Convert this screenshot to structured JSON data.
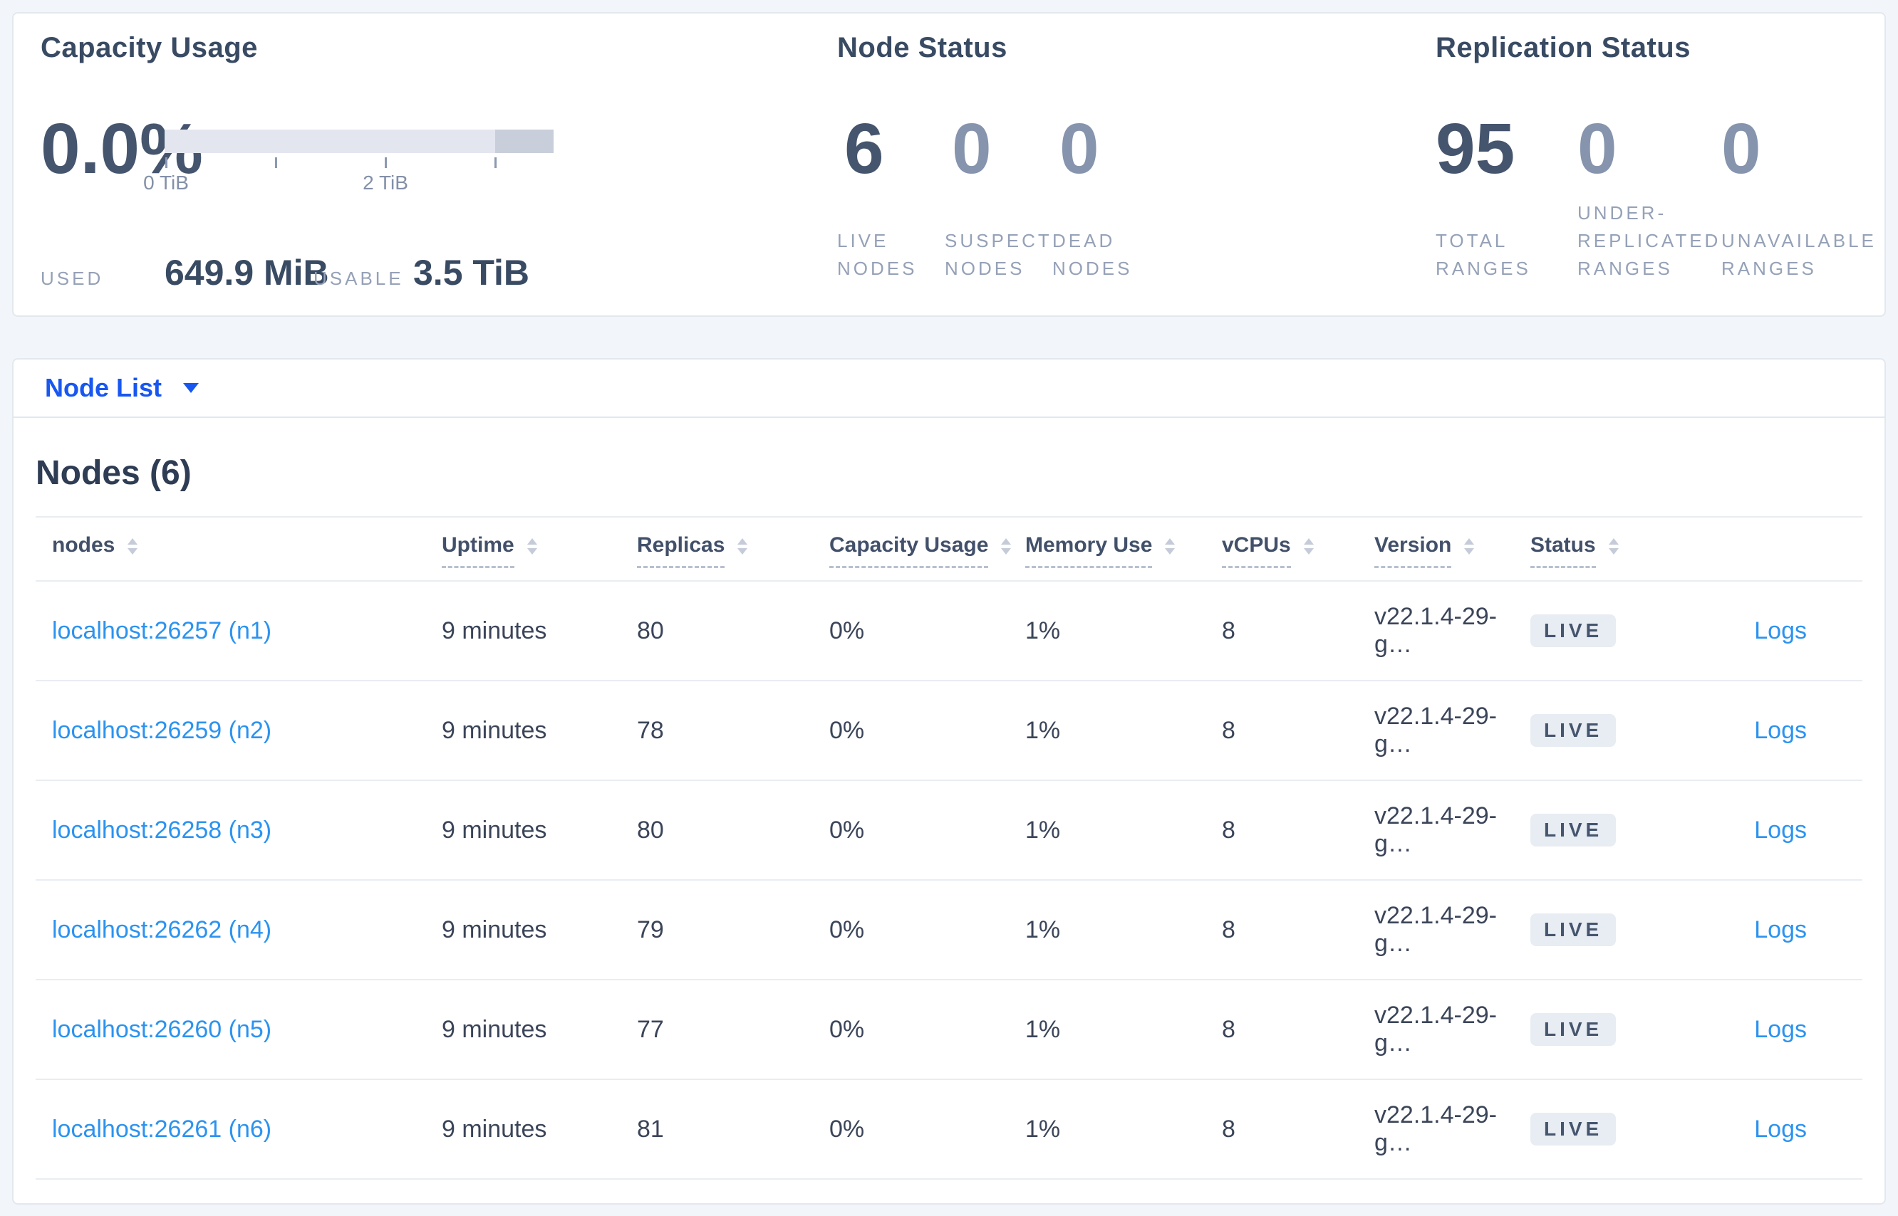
{
  "panels": {
    "capacity": {
      "title": "Capacity Usage",
      "percent": "0.0%",
      "tick_first": "0 TiB",
      "tick_third": "2 TiB",
      "used_label": "USED",
      "used_value": "649.9 MiB",
      "usable_label": "USABLE",
      "usable_value": "3.5 TiB"
    },
    "node_status": {
      "title": "Node Status",
      "stats": [
        {
          "value": "6",
          "label": "LIVE NODES"
        },
        {
          "value": "0",
          "label": "SUSPECT NODES"
        },
        {
          "value": "0",
          "label": "DEAD NODES"
        }
      ]
    },
    "replication": {
      "title": "Replication Status",
      "stats": [
        {
          "value": "95",
          "label": "TOTAL RANGES"
        },
        {
          "value": "0",
          "label": "UNDER-REPLICATED RANGES"
        },
        {
          "value": "0",
          "label": "UNAVAILABLE RANGES"
        }
      ]
    }
  },
  "node_list_dropdown": {
    "label": "Node List"
  },
  "table": {
    "heading": "Nodes (6)",
    "columns": [
      "nodes",
      "Uptime",
      "Replicas",
      "Capacity Usage",
      "Memory Use",
      "vCPUs",
      "Version",
      "Status"
    ],
    "logs_label": "Logs",
    "rows": [
      {
        "node": "localhost:26257 (n1)",
        "uptime": "9 minutes",
        "replicas": "80",
        "capacity": "0%",
        "memory": "1%",
        "vcpus": "8",
        "version": "v22.1.4-29-g…",
        "status": "LIVE"
      },
      {
        "node": "localhost:26259 (n2)",
        "uptime": "9 minutes",
        "replicas": "78",
        "capacity": "0%",
        "memory": "1%",
        "vcpus": "8",
        "version": "v22.1.4-29-g…",
        "status": "LIVE"
      },
      {
        "node": "localhost:26258 (n3)",
        "uptime": "9 minutes",
        "replicas": "80",
        "capacity": "0%",
        "memory": "1%",
        "vcpus": "8",
        "version": "v22.1.4-29-g…",
        "status": "LIVE"
      },
      {
        "node": "localhost:26262 (n4)",
        "uptime": "9 minutes",
        "replicas": "79",
        "capacity": "0%",
        "memory": "1%",
        "vcpus": "8",
        "version": "v22.1.4-29-g…",
        "status": "LIVE"
      },
      {
        "node": "localhost:26260 (n5)",
        "uptime": "9 minutes",
        "replicas": "77",
        "capacity": "0%",
        "memory": "1%",
        "vcpus": "8",
        "version": "v22.1.4-29-g…",
        "status": "LIVE"
      },
      {
        "node": "localhost:26261 (n6)",
        "uptime": "9 minutes",
        "replicas": "81",
        "capacity": "0%",
        "memory": "1%",
        "vcpus": "8",
        "version": "v22.1.4-29-g…",
        "status": "LIVE"
      }
    ]
  },
  "colors": {
    "dropdown_blue": "#1857f0",
    "link_blue": "#2b93f0",
    "badge_bg": "#e8ecf3",
    "badge_text": "#46556e",
    "bar_track": "#e3e6ef",
    "bar_segment": "#c9cfda",
    "page_bg": "#f2f5f9"
  }
}
